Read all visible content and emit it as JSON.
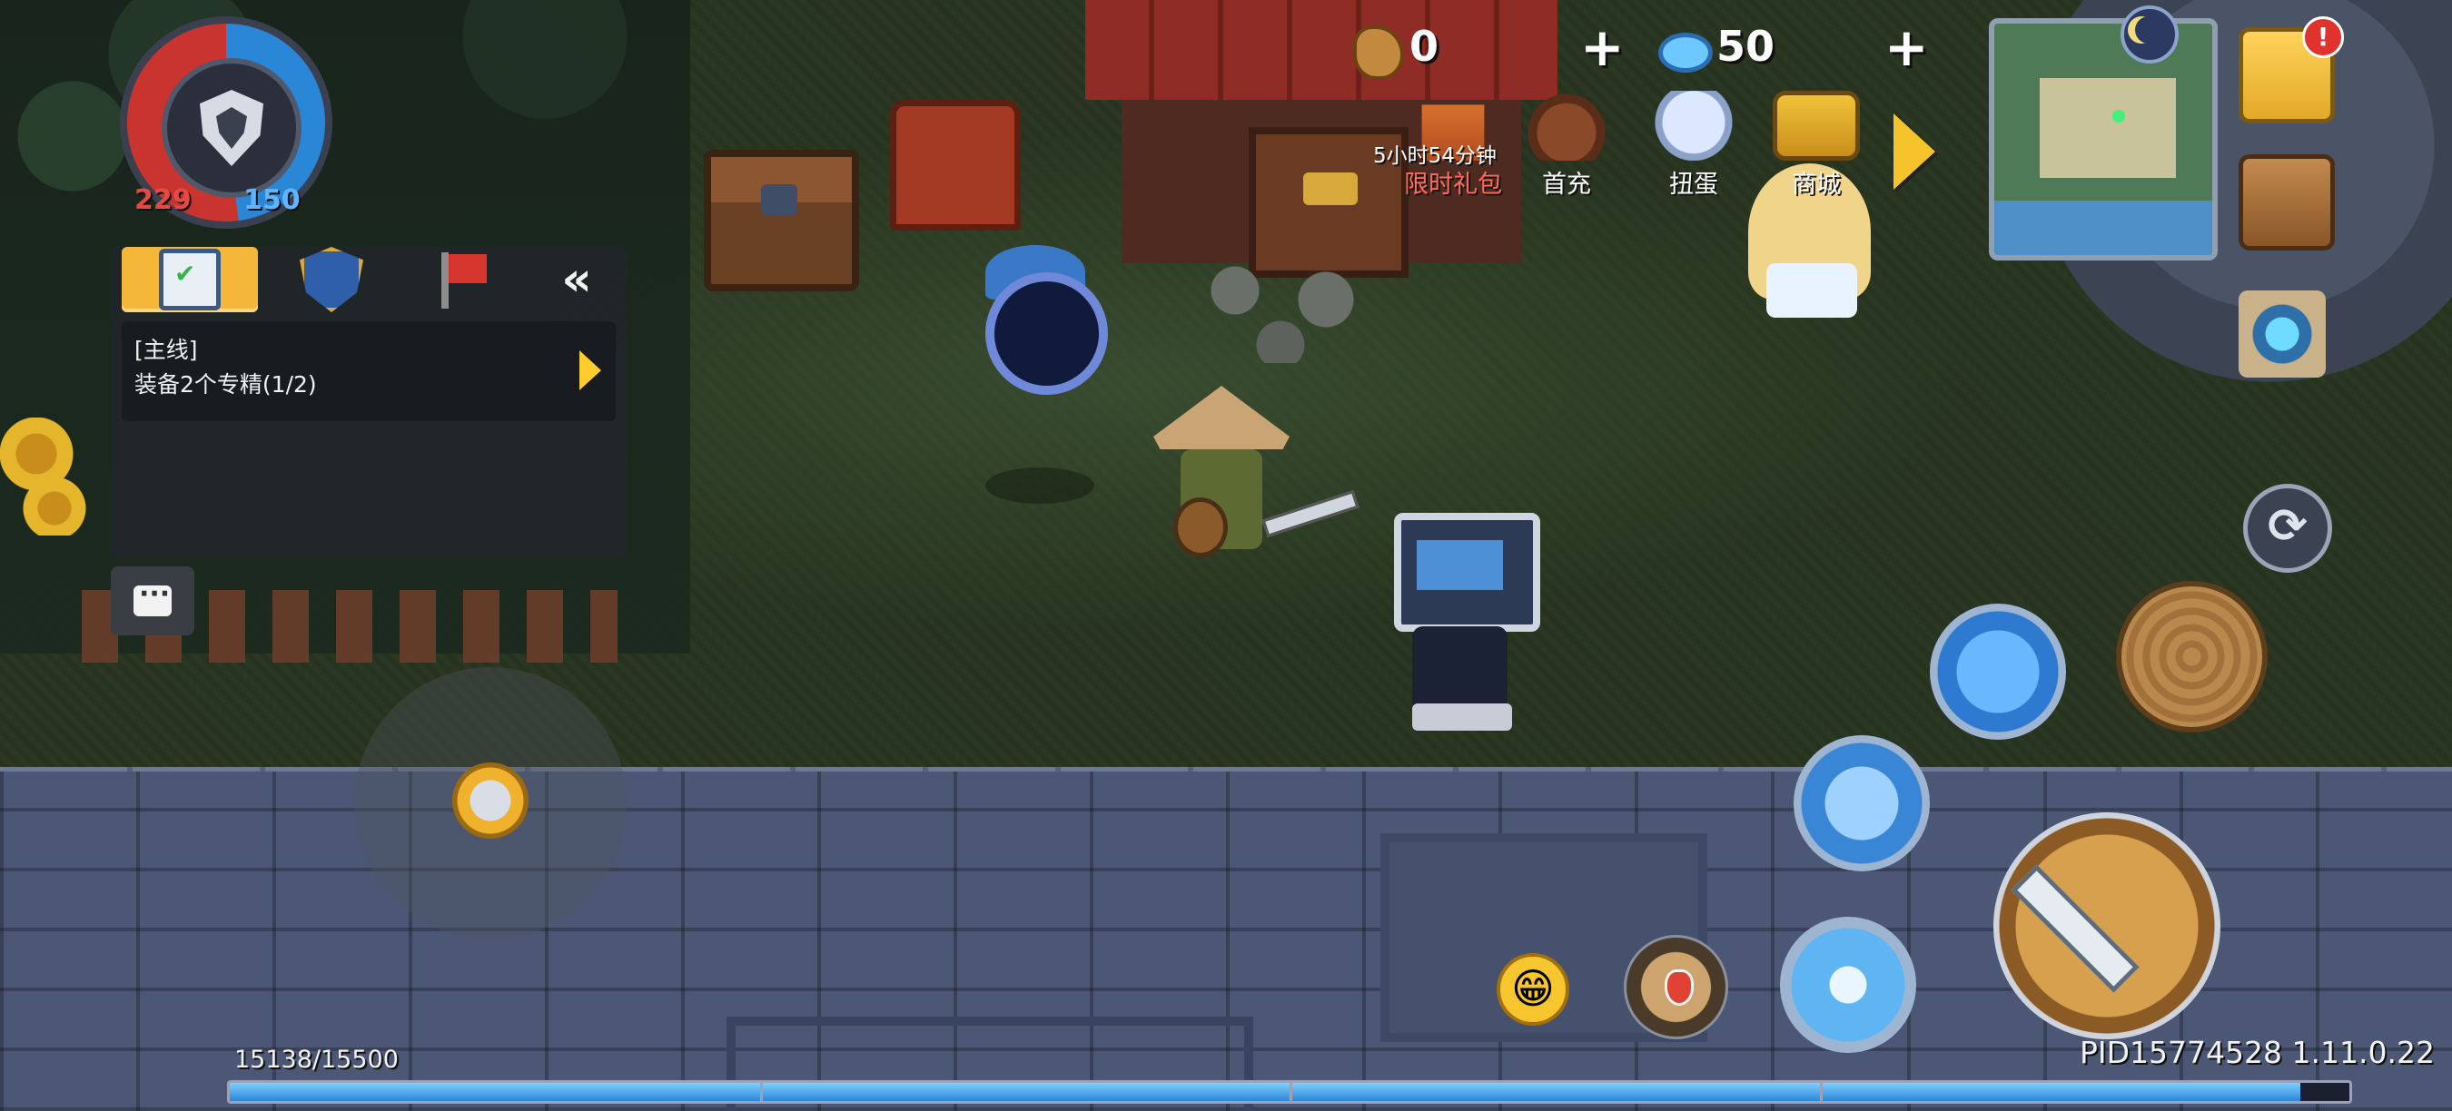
{
  "status": {
    "hp": "229",
    "shield": "150"
  },
  "quest_panel": {
    "tabs": [
      {
        "icon": "clipboard-icon",
        "active": true
      },
      {
        "icon": "badge-icon",
        "active": false
      },
      {
        "icon": "flag-icon",
        "active": false
      }
    ],
    "collapse_label": "«",
    "quest_tag": "[主线]",
    "quest_text": "装备2个专精(1/2)"
  },
  "currencies": {
    "coins": "0",
    "gems": "50",
    "add_label": "+"
  },
  "events": {
    "gift_timer": "5小时54分钟",
    "gift_label": "限时礼包",
    "topup_label": "首充",
    "gacha_label": "扭蛋",
    "shop_label": "商城"
  },
  "notifications": {
    "mail_badge": "!"
  },
  "controls": {
    "swap_label": "⟳",
    "emoji_label": "😁"
  },
  "experience": {
    "text": "15138/15500",
    "fraction": 0.977
  },
  "footer": {
    "pid_version": "PID15774528 1.11.0.22"
  },
  "colors": {
    "hp": "#e34a43",
    "shield": "#61b4ff",
    "accent_gold": "#f4b73a",
    "gift_label": "#ff6b5a"
  }
}
